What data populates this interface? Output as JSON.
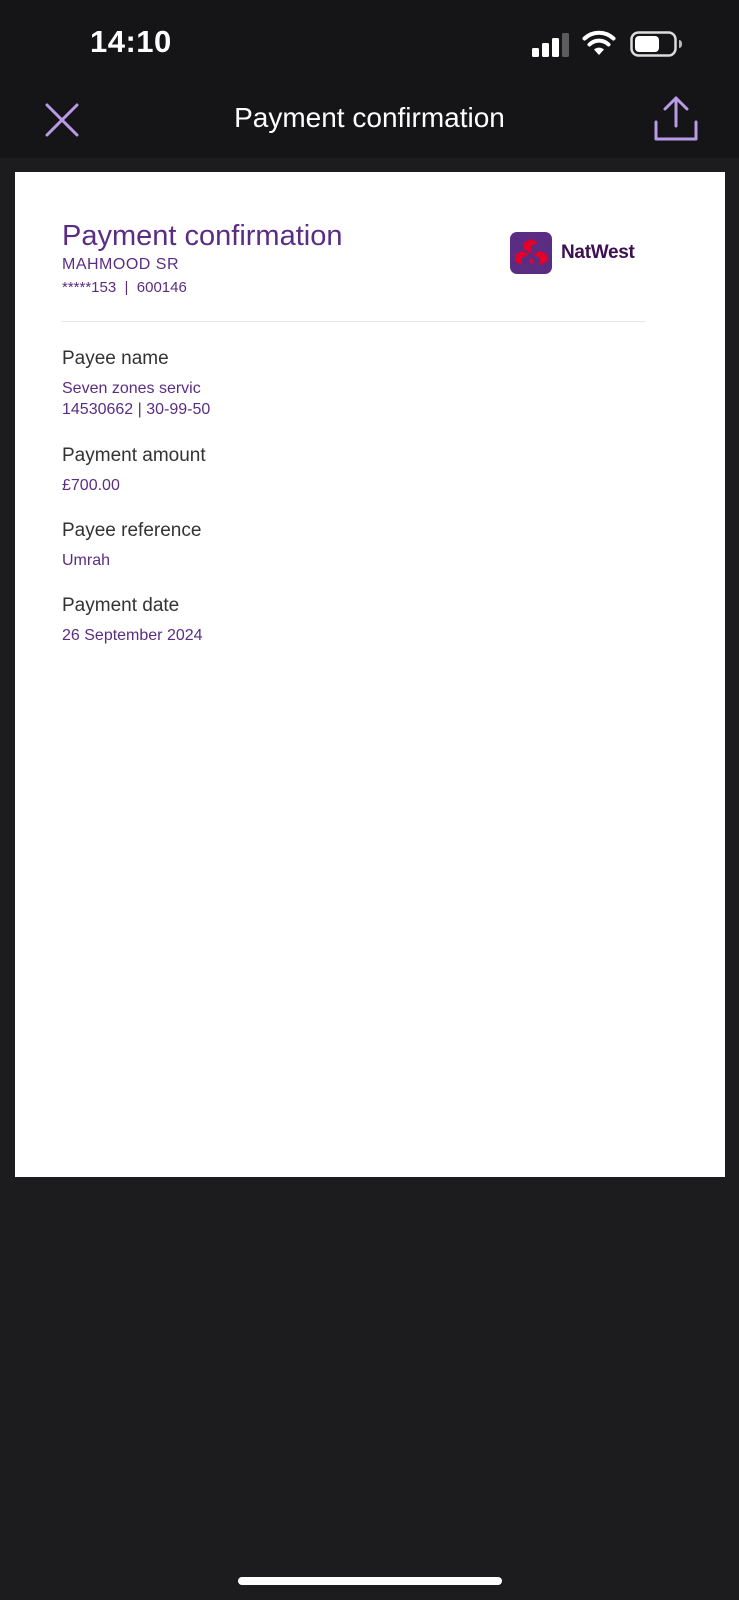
{
  "status_bar": {
    "time": "14:10"
  },
  "nav": {
    "title": "Payment confirmation",
    "close_icon": "close-icon",
    "share_icon": "share-icon",
    "accent_color": "#b89ae6"
  },
  "document": {
    "title": "Payment confirmation",
    "account_name": "MAHMOOD SR",
    "account_number": "*****153  |  600146",
    "brand": {
      "name": "NatWest",
      "logo_color": "#5a2d82",
      "cube_color": "#e60028"
    },
    "fields": [
      {
        "label": "Payee name",
        "lines": [
          "Seven zones servic",
          "14530662 | 30-99-50"
        ]
      },
      {
        "label": "Payment amount",
        "lines": [
          "£700.00"
        ]
      },
      {
        "label": "Payee reference",
        "lines": [
          "Umrah"
        ]
      },
      {
        "label": "Payment date",
        "lines": [
          "26 September 2024"
        ]
      }
    ]
  }
}
